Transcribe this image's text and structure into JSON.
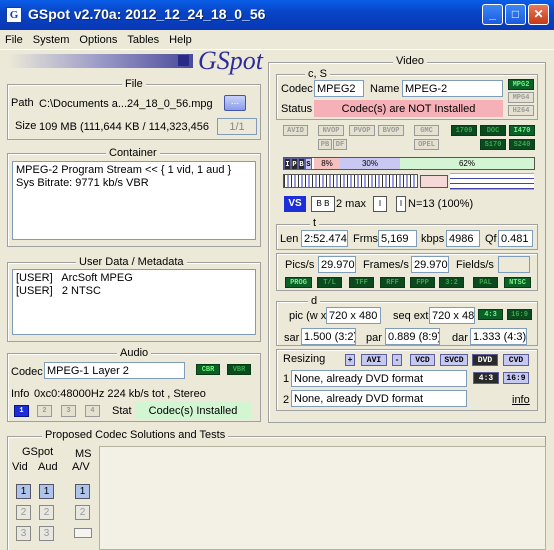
{
  "window": {
    "title": "GSpot v2.70a: 2012_12_24_18_0_56",
    "icon": "G",
    "min": "_",
    "max": "□",
    "close": "✕"
  },
  "menu": [
    "File",
    "System",
    "Options",
    "Tables",
    "Help"
  ],
  "logo": "GSpot",
  "file": {
    "title": "File",
    "path_label": "Path",
    "path_value": "C:\\Documents a...24_18_0_56.mpg",
    "browse": "...",
    "size_label": "Size",
    "size_value": "109 MB (111,644 KB / 114,323,456",
    "parts": "1/1"
  },
  "container": {
    "title": "Container",
    "text": "MPEG-2 Program Stream << { 1 vid, 1 aud }\nSys Bitrate: 9771 kb/s VBR"
  },
  "userdata": {
    "title": "User Data / Metadata",
    "text": "[USER]   ArcSoft MPEG\n[USER]   2 NTSC"
  },
  "audio": {
    "title": "Audio",
    "codec_label": "Codec",
    "codec_value": "MPEG-1 Layer 2",
    "cbr": "CBR",
    "vbr": "VBR",
    "info_label": "Info",
    "info_value": "0xc0:48000Hz  224 kb/s tot , Stereo",
    "stream_buttons": [
      "1",
      "2",
      "3",
      "4"
    ],
    "stat_label": "Stat",
    "stat_value": "Codec(s) Installed"
  },
  "video": {
    "title": "Video",
    "cs_label": "c, S",
    "codec_label": "Codec",
    "codec_value": "MPEG2",
    "name_label": "Name",
    "name_value": "MPEG-2",
    "status_label": "Status",
    "status_value": "Codec(s) are NOT Installed",
    "tags_right": [
      "MPG2",
      "MPG4",
      "H264"
    ],
    "tags_row1": [
      "AVID",
      "NVOP",
      "PVOP",
      "BVOP",
      "GMC",
      "1709",
      "DOC",
      "I470"
    ],
    "tags_row2": [
      "PB",
      "DF",
      "OPEL",
      "S170",
      "S240"
    ],
    "frame_types": [
      "I",
      "P",
      "B",
      "S"
    ],
    "pct_I": "8%",
    "pct_P": "30%",
    "pct_B": "62%",
    "b_max": "2 max",
    "n_info": "N=13 (100%)",
    "t_label": "t",
    "len_label": "Len",
    "len_value": "2:52.474",
    "frms_label": "Frms",
    "frms_value": "5,169",
    "kbps_label": "kbps",
    "kbps_value": "4986",
    "qf_label": "Qf",
    "qf_value": "0.481",
    "pics_label": "Pics/s",
    "pics_value": "29.970",
    "frames_label": "Frames/s",
    "frames_value": "29.970",
    "fields_label": "Fields/s",
    "fields_value": "",
    "flag_tags": [
      "PROG",
      "T/L",
      "TFF",
      "RFF",
      "FPP",
      "3:2",
      "PAL",
      "NTSC"
    ],
    "d_label": "d",
    "pic_label": "pic (w x h)",
    "pic_value": "720 x 480",
    "seqext_label": "seq ext",
    "seqext_value": "720 x 480",
    "tag43": "4:3",
    "tag169": "16:9",
    "sar_label": "sar",
    "sar_value": "1.500 (3:2)",
    "par_label": "par",
    "par_value": "0.889 (8:9)",
    "dar_label": "dar",
    "dar_value": "1.333 (4:3)",
    "resizing_label": "Resizing",
    "resize_plus": "+",
    "resize_avi": "AVI",
    "resize_minus": "-",
    "resize_vcd": "VCD",
    "resize_svcd": "SVCD",
    "resize_dvd": "DVD",
    "resize_cvd": "CVD",
    "row1_num": "1",
    "row1_value": "None, already DVD format",
    "row1_a": "4:3",
    "row1_b": "16:9",
    "row2_num": "2",
    "row2_value": "None, already DVD format",
    "info_link": "info"
  },
  "proposed": {
    "title": "Proposed Codec Solutions and Tests",
    "gspot": "GSpot",
    "vid": "Vid",
    "aud": "Aud",
    "ms": "MS",
    "av": "A/V",
    "vid_buttons": [
      "1",
      "2",
      "3"
    ],
    "aud_buttons": [
      "1",
      "2",
      "3"
    ],
    "ms_buttons": [
      "1",
      "2"
    ]
  },
  "colors": {
    "accent": "#0a5ee8",
    "green": "#0c5f26",
    "status_bad": "#f6b0b8",
    "status_ok": "#d2f5d2"
  }
}
